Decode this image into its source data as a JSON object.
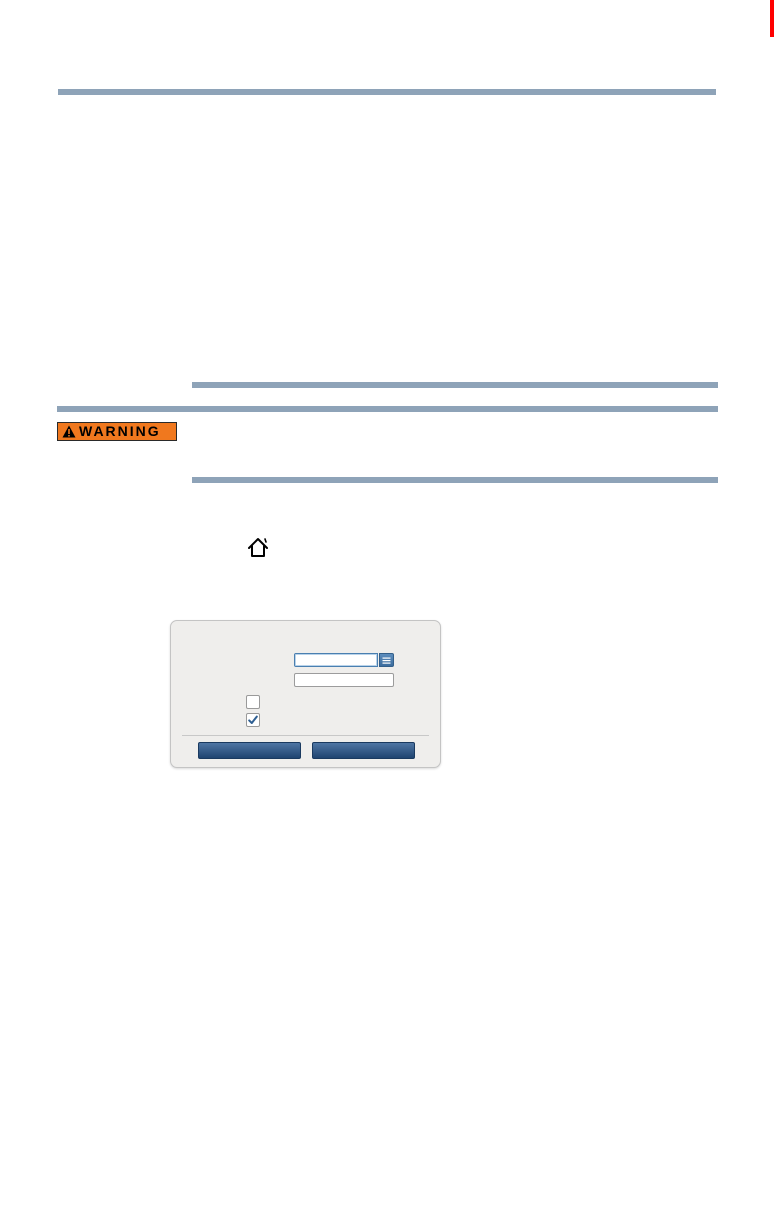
{
  "page": {
    "warning": {
      "label": "WARNING",
      "icon": "warning-triangle-icon",
      "color": "#f0781e"
    },
    "home_icon": "home-icon",
    "rule_color": "#8ea3b8",
    "crop_mark_color": "#ff0000"
  },
  "dialog": {
    "dropdown": {
      "value": "",
      "button_icon": "list-icon",
      "accent": "#4a7fb0"
    },
    "text_field": {
      "value": ""
    },
    "checkboxes": [
      {
        "checked": false
      },
      {
        "checked": true
      }
    ],
    "buttons": [
      {
        "label": ""
      },
      {
        "label": ""
      }
    ],
    "button_color": "#2b4f7c"
  }
}
